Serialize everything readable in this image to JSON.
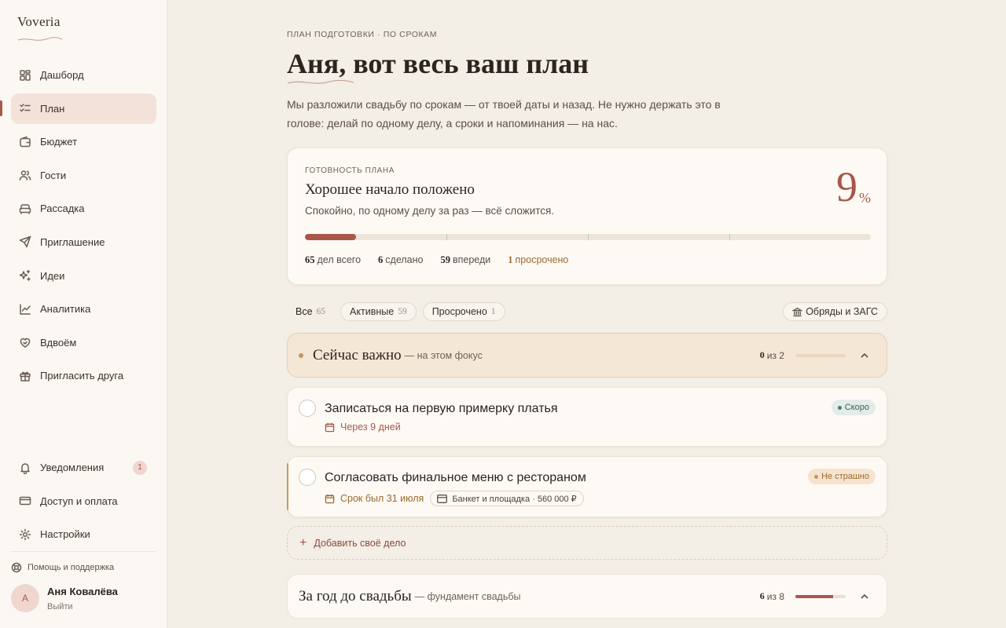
{
  "app": {
    "logo": "Voveria"
  },
  "sidebar": {
    "items": [
      {
        "label": "Дашборд",
        "icon": "dashboard-icon"
      },
      {
        "label": "План",
        "icon": "checklist-icon",
        "active": true
      },
      {
        "label": "Бюджет",
        "icon": "wallet-icon"
      },
      {
        "label": "Гости",
        "icon": "users-icon"
      },
      {
        "label": "Рассадка",
        "icon": "sofa-icon"
      },
      {
        "label": "Приглашение",
        "icon": "send-icon"
      },
      {
        "label": "Идеи",
        "icon": "sparkles-icon"
      },
      {
        "label": "Аналитика",
        "icon": "chart-line-icon"
      },
      {
        "label": "Вдвоём",
        "icon": "hearts-icon"
      },
      {
        "label": "Пригласить друга",
        "icon": "gift-icon"
      }
    ],
    "bottom": [
      {
        "label": "Уведомления",
        "icon": "bell-icon",
        "badge": "1"
      },
      {
        "label": "Доступ и оплата",
        "icon": "credit-card-icon"
      },
      {
        "label": "Настройки",
        "icon": "gear-icon"
      }
    ],
    "help": "Помощь и поддержка",
    "user": {
      "initial": "А",
      "name": "Аня Ковалёва",
      "logout": "Выйти"
    }
  },
  "page": {
    "eyebrow": "ПЛАН ПОДГОТОВКИ · ПО СРОКАМ",
    "title": "Аня, вот весь ваш план",
    "subtitle": "Мы разложили свадьбу по срокам — от твоей даты и назад. Не нужно держать это в голове: делай по одному делу, а сроки и напоминания — на нас."
  },
  "progress": {
    "label": "ГОТОВНОСТЬ ПЛАНА",
    "title": "Хорошее начало положено",
    "subtitle": "Спокойно, по одному делу за раз — всё сложится.",
    "percent": "9",
    "percent_sign": "%",
    "fill_percent": 9,
    "stats": {
      "total_num": "65",
      "total_label": "дел всего",
      "done_num": "6",
      "done_label": "сделано",
      "ahead_num": "59",
      "ahead_label": "впереди",
      "overdue_num": "1",
      "overdue_label": "просрочено"
    }
  },
  "filters": {
    "all": {
      "label": "Все",
      "count": "65"
    },
    "active": {
      "label": "Активные",
      "count": "59"
    },
    "overdue": {
      "label": "Просрочено",
      "count": "1"
    },
    "category": "Обряды и ЗАГС"
  },
  "sections": {
    "focus": {
      "title": "Сейчас важно",
      "subtitle": "— на этом фокус",
      "done": "0",
      "of": "из 2",
      "progress": 0
    },
    "year": {
      "title": "За год до свадьбы",
      "subtitle": "— фундамент свадьбы",
      "done": "6",
      "of": "из 8",
      "progress": 0.75
    }
  },
  "tasks": [
    {
      "title": "Записаться на первую примерку платья",
      "date": "Через 9 дней",
      "status": "Скоро"
    },
    {
      "title": "Согласовать финальное меню с рестораном",
      "date": "Срок был 31 июля",
      "budget": "Банкет и площадка · 560 000 ₽",
      "status": "Не страшно"
    }
  ],
  "add_task": "Добавить своё дело",
  "colors": {
    "accent": "#a8574a",
    "focus_bg": "#f5e7d6",
    "warn": "#9a6a2e",
    "soon": "#4d7a70"
  }
}
